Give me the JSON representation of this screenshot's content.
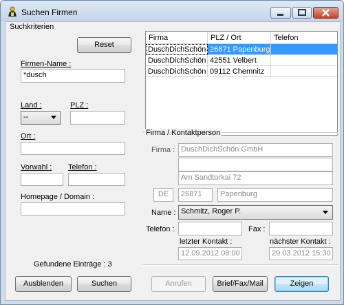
{
  "window": {
    "title": "Suchen Firmen"
  },
  "search": {
    "group_title": "Suchkriterien",
    "reset_label": "Reset",
    "firmenname_label": "Firmen-Name :",
    "firmenname_value": "*dusch",
    "land_label": "Land :",
    "land_value": "--",
    "plz_label": "PLZ :",
    "plz_value": "",
    "ort_label": "Ort :",
    "ort_value": "",
    "vorwahl_label": "Vorwahl :",
    "vorwahl_value": "",
    "telefon_label": "Telefon :",
    "telefon_value": "",
    "homepage_label": "Homepage / Domain :",
    "homepage_value": "",
    "found_text": "Gefundene Einträge : 3",
    "hide_label": "Ausblenden",
    "search_label": "Suchen"
  },
  "results": {
    "columns": [
      "Firma",
      "PLZ / Ort",
      "Telefon"
    ],
    "rows": [
      {
        "firma": "DuschDichSchön",
        "plzort": "26871 Papenburg",
        "telefon": ""
      },
      {
        "firma": "DuschDichSchön",
        "plzort": "42551 Velbert",
        "telefon": ""
      },
      {
        "firma": "DuschDichSchön",
        "plzort": "09112 Chemnitz",
        "telefon": ""
      }
    ]
  },
  "contact": {
    "group_title": "Firma / Kontaktperson",
    "firma_label": "Firma :",
    "firma_line1": "DuschDichSchön GmbH",
    "firma_line2": "",
    "street": "Am Sandtorkai 72",
    "country": "DE",
    "zip": "26871",
    "city": "Papenburg",
    "name_label": "Name :",
    "name_value": "Schmitz, Roger P.",
    "telefon_label": "Telefon :",
    "telefon_value": "",
    "fax_label": "Fax :",
    "fax_value": "",
    "last_contact_label": "letzter Kontakt :",
    "last_contact_value": "12.09.2012 08:00",
    "next_contact_label": "nächster Kontakt :",
    "next_contact_value": "29.03.2012 15:30",
    "call_label": "Anrufen",
    "mail_label": "Brief/Fax/Mail",
    "show_label": "Zeigen"
  }
}
